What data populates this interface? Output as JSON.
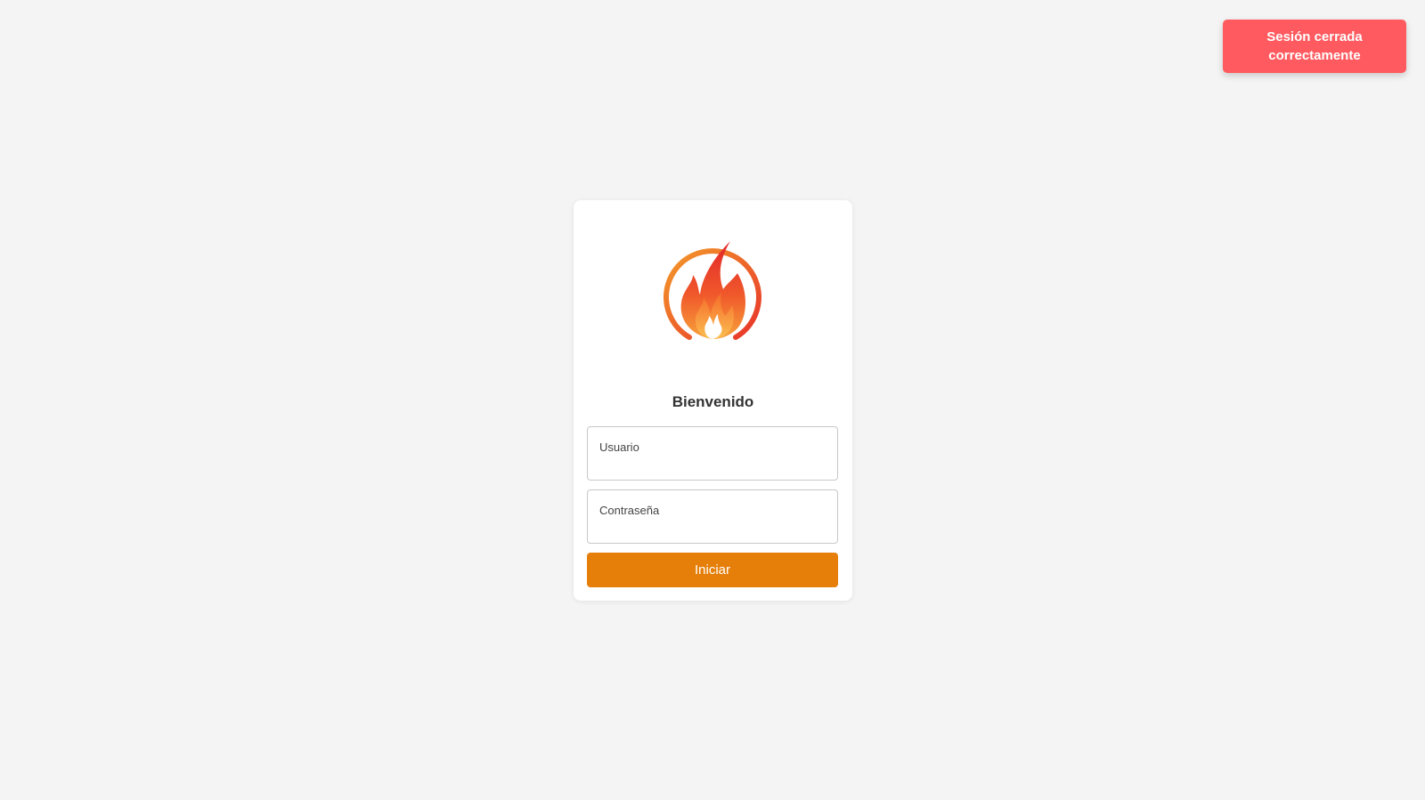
{
  "toast": {
    "message": "Sesión cerrada correctamente",
    "color": "#ff5a5f"
  },
  "login": {
    "logo_icon": "flame-icon",
    "title": "Bienvenido",
    "username_placeholder": "Usuario",
    "password_placeholder": "Contraseña",
    "submit_label": "Iniciar",
    "accent_color": "#e57f0a"
  }
}
